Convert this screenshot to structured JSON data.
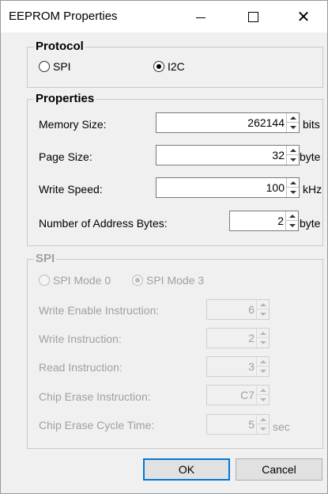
{
  "window": {
    "title": "EEPROM Properties",
    "minimize_label": "—",
    "maximize_label": "☐",
    "close_label": "✕"
  },
  "protocol": {
    "label": "Protocol",
    "options": [
      {
        "label": "SPI",
        "checked": false
      },
      {
        "label": "I2C",
        "checked": true
      }
    ]
  },
  "properties": {
    "label": "Properties",
    "rows": [
      {
        "label": "Memory Size:",
        "value": "262144",
        "unit": "bits"
      },
      {
        "label": "Page Size:",
        "value": "32",
        "unit": "byte"
      },
      {
        "label": "Write Speed:",
        "value": "100",
        "unit": "kHz"
      },
      {
        "label": "Number of Address Bytes:",
        "value": "2",
        "unit": "byte"
      }
    ]
  },
  "spi": {
    "label": "SPI",
    "modes": [
      {
        "label": "SPI Mode 0",
        "checked": false
      },
      {
        "label": "SPI Mode 3",
        "checked": true
      }
    ],
    "rows": [
      {
        "label": "Write Enable Instruction:",
        "value": "6",
        "unit": ""
      },
      {
        "label": "Write Instruction:",
        "value": "2",
        "unit": ""
      },
      {
        "label": "Read Instruction:",
        "value": "3",
        "unit": ""
      },
      {
        "label": "Chip Erase Instruction:",
        "value": "C7",
        "unit": ""
      },
      {
        "label": "Chip Erase Cycle Time:",
        "value": "5",
        "unit": "sec"
      }
    ]
  },
  "buttons": {
    "ok": "OK",
    "cancel": "Cancel"
  }
}
